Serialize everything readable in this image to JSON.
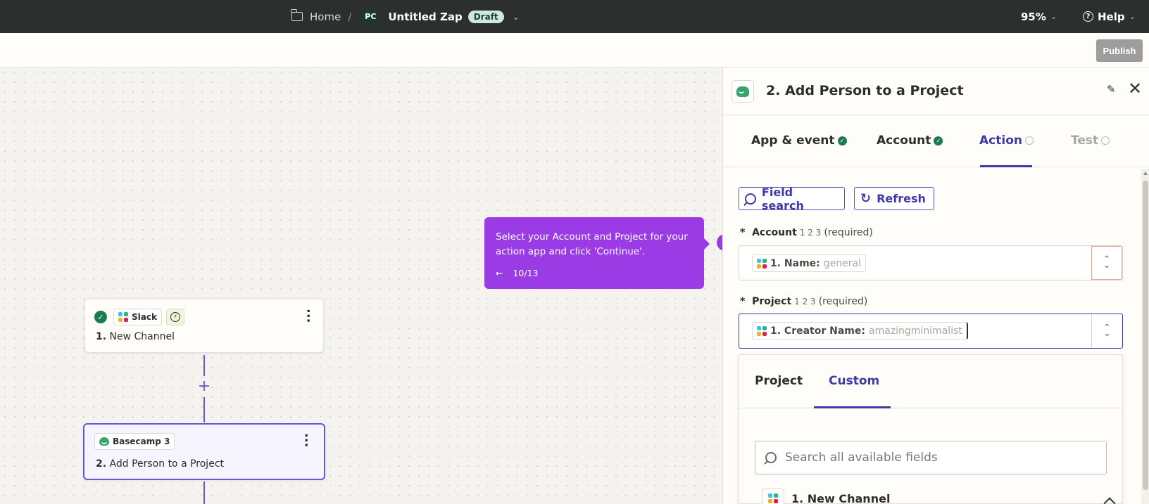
{
  "topbar": {
    "home_label": "Home",
    "separator": "/",
    "avatar_initials": "PC",
    "zap_name": "Untitled Zap",
    "status_badge": "Draft",
    "zoom_level": "95%",
    "help_label": "Help"
  },
  "subbar": {
    "publish_label": "Publish"
  },
  "canvas": {
    "step1": {
      "app_name": "Slack",
      "number": "1.",
      "title": "New Channel"
    },
    "step2": {
      "app_name": "Basecamp 3",
      "number": "2.",
      "title": "Add Person to a Project"
    },
    "plus_symbol": "+"
  },
  "tooltip": {
    "text": "Select your Account and Project for your action app and click 'Continue'.",
    "back_arrow": "←",
    "progress": "10/13"
  },
  "panel": {
    "title": "2. Add Person to a Project",
    "tabs": [
      {
        "label": "App & event",
        "state": "complete"
      },
      {
        "label": "Account",
        "state": "complete"
      },
      {
        "label": "Action",
        "state": "active"
      },
      {
        "label": "Test",
        "state": "disabled"
      }
    ],
    "buttons": {
      "field_search": "Field search",
      "refresh": "Refresh"
    },
    "fields": {
      "account": {
        "star": "*",
        "label": "Account",
        "nums": "1 2 3",
        "required": "(required)",
        "chip_key": "1. Name:",
        "chip_value": "general"
      },
      "project": {
        "star": "*",
        "label": "Project",
        "nums": "1 2 3",
        "required": "(required)",
        "chip_key": "1. Creator Name:",
        "chip_value": "amazingminimalist"
      }
    },
    "dropdown": {
      "tabs": [
        "Project",
        "Custom"
      ],
      "active_tab": "Custom",
      "search_placeholder": "Search all available fields",
      "group_label": "1. New Channel"
    }
  },
  "colors": {
    "topbar_bg": "#2d2e2e",
    "accent": "#3f3aa8",
    "tooltip_bg": "#9a3be6",
    "success": "#1d7a4f",
    "step_border_active": "#6a57d8"
  }
}
